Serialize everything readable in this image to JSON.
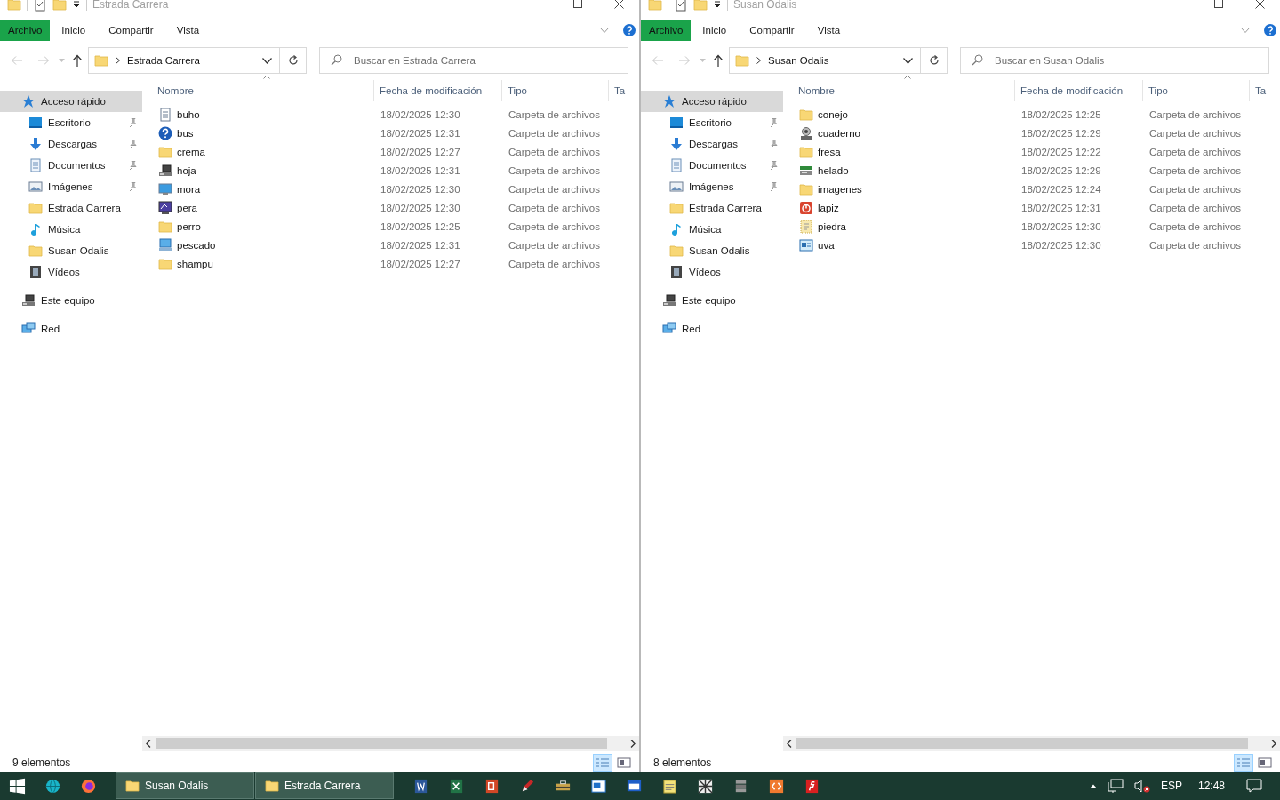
{
  "windows": [
    {
      "title": "Estrada Carrera",
      "ribbon_tabs": [
        {
          "label": "Archivo",
          "kind": "file"
        },
        {
          "label": "Inicio",
          "kind": "tab"
        },
        {
          "label": "Compartir",
          "kind": "tab"
        },
        {
          "label": "Vista",
          "kind": "tab"
        }
      ],
      "address": "Estrada Carrera",
      "search": {
        "placeholder": "Buscar en Estrada Carrera"
      },
      "nav": [
        {
          "label": "Acceso rápido",
          "kind": "star",
          "pinned": false,
          "selected": true,
          "children": [
            {
              "label": "Escritorio",
              "kind": "desktop",
              "pinned": true,
              "selected": false
            },
            {
              "label": "Descargas",
              "kind": "download",
              "pinned": true,
              "selected": false
            },
            {
              "label": "Documentos",
              "kind": "documents",
              "pinned": true,
              "selected": false
            },
            {
              "label": "Imágenes",
              "kind": "pictures",
              "pinned": true,
              "selected": false
            },
            {
              "label": "Estrada Carrera",
              "kind": "folder",
              "pinned": false,
              "selected": false
            },
            {
              "label": "Música",
              "kind": "music",
              "pinned": false,
              "selected": false
            },
            {
              "label": "Susan Odalis",
              "kind": "folder",
              "pinned": false,
              "selected": false
            },
            {
              "label": "Vídeos",
              "kind": "videos",
              "pinned": false,
              "selected": false
            }
          ]
        },
        {
          "label": "Este equipo",
          "kind": "computer",
          "pinned": false,
          "selected": false
        },
        {
          "label": "Red",
          "kind": "network",
          "pinned": false,
          "selected": false
        }
      ],
      "columns": [
        "Nombre",
        "Fecha de modificación",
        "Tipo",
        "Ta"
      ],
      "rows": [
        {
          "name": "buho",
          "kind": "document",
          "date": "18/02/2025 12:30",
          "type": "Carpeta de archivos"
        },
        {
          "name": "bus",
          "kind": "help",
          "date": "18/02/2025 12:31",
          "type": "Carpeta de archivos"
        },
        {
          "name": "crema",
          "kind": "folder",
          "date": "18/02/2025 12:27",
          "type": "Carpeta de archivos"
        },
        {
          "name": "hoja",
          "kind": "computer",
          "date": "18/02/2025 12:31",
          "type": "Carpeta de archivos"
        },
        {
          "name": "mora",
          "kind": "monitor",
          "date": "18/02/2025 12:30",
          "type": "Carpeta de archivos"
        },
        {
          "name": "pera",
          "kind": "display",
          "date": "18/02/2025 12:30",
          "type": "Carpeta de archivos"
        },
        {
          "name": "perro",
          "kind": "folder",
          "date": "18/02/2025 12:25",
          "type": "Carpeta de archivos"
        },
        {
          "name": "pescado",
          "kind": "screen",
          "date": "18/02/2025 12:31",
          "type": "Carpeta de archivos"
        },
        {
          "name": "shampu",
          "kind": "folder",
          "date": "18/02/2025 12:27",
          "type": "Carpeta de archivos"
        }
      ],
      "status": "9 elementos"
    },
    {
      "title": "Susan Odalis",
      "ribbon_tabs": [
        {
          "label": "Archivo",
          "kind": "file"
        },
        {
          "label": "Inicio",
          "kind": "tab"
        },
        {
          "label": "Compartir",
          "kind": "tab"
        },
        {
          "label": "Vista",
          "kind": "tab"
        }
      ],
      "address": "Susan Odalis",
      "search": {
        "placeholder": "Buscar en Susan Odalis"
      },
      "nav": [
        {
          "label": "Acceso rápido",
          "kind": "star",
          "pinned": false,
          "selected": true,
          "children": [
            {
              "label": "Escritorio",
              "kind": "desktop",
              "pinned": true,
              "selected": false
            },
            {
              "label": "Descargas",
              "kind": "download",
              "pinned": true,
              "selected": false
            },
            {
              "label": "Documentos",
              "kind": "documents",
              "pinned": true,
              "selected": false
            },
            {
              "label": "Imágenes",
              "kind": "pictures",
              "pinned": true,
              "selected": false
            },
            {
              "label": "Estrada Carrera",
              "kind": "folder",
              "pinned": false,
              "selected": false
            },
            {
              "label": "Música",
              "kind": "music",
              "pinned": false,
              "selected": false
            },
            {
              "label": "Susan Odalis",
              "kind": "folder",
              "pinned": false,
              "selected": false
            },
            {
              "label": "Vídeos",
              "kind": "videos",
              "pinned": false,
              "selected": false
            }
          ]
        },
        {
          "label": "Este equipo",
          "kind": "computer",
          "pinned": false,
          "selected": false
        },
        {
          "label": "Red",
          "kind": "network",
          "pinned": false,
          "selected": false
        }
      ],
      "columns": [
        "Nombre",
        "Fecha de modificación",
        "Tipo",
        "Ta"
      ],
      "rows": [
        {
          "name": "conejo",
          "kind": "folder",
          "date": "18/02/2025 12:25",
          "type": "Carpeta de archivos"
        },
        {
          "name": "cuaderno",
          "kind": "device",
          "date": "18/02/2025 12:29",
          "type": "Carpeta de archivos"
        },
        {
          "name": "fresa",
          "kind": "folder",
          "date": "18/02/2025 12:22",
          "type": "Carpeta de archivos"
        },
        {
          "name": "helado",
          "kind": "drive",
          "date": "18/02/2025 12:29",
          "type": "Carpeta de archivos"
        },
        {
          "name": "imagenes",
          "kind": "folder",
          "date": "18/02/2025 12:24",
          "type": "Carpeta de archivos"
        },
        {
          "name": "lapiz",
          "kind": "power",
          "date": "18/02/2025 12:31",
          "type": "Carpeta de archivos"
        },
        {
          "name": "piedra",
          "kind": "dotted",
          "date": "18/02/2025 12:30",
          "type": "Carpeta de archivos"
        },
        {
          "name": "uva",
          "kind": "window",
          "date": "18/02/2025 12:30",
          "type": "Carpeta de archivos"
        }
      ],
      "status": "8 elementos"
    }
  ],
  "taskbar": {
    "pinned_left": [
      {
        "kind": "globe"
      },
      {
        "kind": "fox"
      }
    ],
    "windows": [
      {
        "label": "Susan Odalis"
      },
      {
        "label": "Estrada Carrera"
      }
    ],
    "pinned_right": [
      {
        "kind": "doc"
      },
      {
        "kind": "sheet"
      },
      {
        "kind": "slides"
      },
      {
        "kind": "pen"
      },
      {
        "kind": "tools"
      },
      {
        "kind": "chat"
      },
      {
        "kind": "win"
      },
      {
        "kind": "notepad"
      },
      {
        "kind": "grid"
      },
      {
        "kind": "stack"
      },
      {
        "kind": "code"
      },
      {
        "kind": "flash"
      }
    ],
    "language": "ESP",
    "time": "12:48"
  }
}
